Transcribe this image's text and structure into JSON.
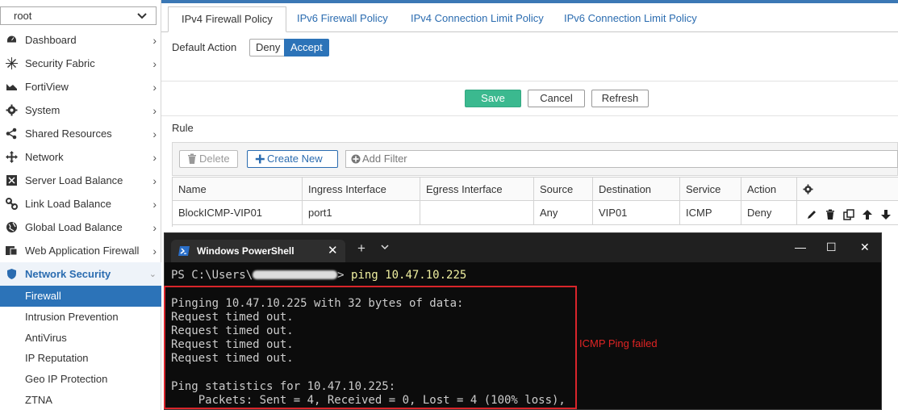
{
  "sidebar": {
    "vdom": "root",
    "items": [
      {
        "label": "Dashboard",
        "icon": "dashboard-icon"
      },
      {
        "label": "Security Fabric",
        "icon": "fabric-icon"
      },
      {
        "label": "FortiView",
        "icon": "chart-icon"
      },
      {
        "label": "System",
        "icon": "gear-icon"
      },
      {
        "label": "Shared Resources",
        "icon": "share-icon"
      },
      {
        "label": "Network",
        "icon": "network-icon"
      },
      {
        "label": "Server Load Balance",
        "icon": "server-icon"
      },
      {
        "label": "Link Load Balance",
        "icon": "link-icon"
      },
      {
        "label": "Global Load Balance",
        "icon": "globe-icon"
      },
      {
        "label": "Web Application Firewall",
        "icon": "waf-icon"
      },
      {
        "label": "Network Security",
        "icon": "shield-icon"
      }
    ],
    "sub_items": [
      {
        "label": "Firewall"
      },
      {
        "label": "Intrusion Prevention"
      },
      {
        "label": "AntiVirus"
      },
      {
        "label": "IP Reputation"
      },
      {
        "label": "Geo IP Protection"
      },
      {
        "label": "ZTNA"
      }
    ]
  },
  "tabs": [
    {
      "label": "IPv4 Firewall Policy"
    },
    {
      "label": "IPv6 Firewall Policy"
    },
    {
      "label": "IPv4 Connection Limit Policy"
    },
    {
      "label": "IPv6 Connection Limit Policy"
    }
  ],
  "default_action": {
    "label": "Default Action",
    "options": [
      "Deny",
      "Accept"
    ],
    "selected": "Accept"
  },
  "actions": {
    "save": "Save",
    "cancel": "Cancel",
    "refresh": "Refresh"
  },
  "rule_section": {
    "title": "Rule",
    "delete_label": "Delete",
    "create_label": "Create New",
    "filter_placeholder": "Add Filter",
    "columns": [
      "Name",
      "Ingress Interface",
      "Egress Interface",
      "Source",
      "Destination",
      "Service",
      "Action"
    ],
    "rows": [
      {
        "name": "BlockICMP-VIP01",
        "ingress": "port1",
        "egress": "",
        "source": "Any",
        "destination": "VIP01",
        "service": "ICMP",
        "action": "Deny"
      }
    ]
  },
  "powershell": {
    "tab_title": "Windows PowerShell",
    "prompt_prefix": "PS C:\\Users\\",
    "prompt_suffix": "> ",
    "command": "ping 10.47.10.225",
    "output": [
      "Pinging 10.47.10.225 with 32 bytes of data:",
      "Request timed out.",
      "Request timed out.",
      "Request timed out.",
      "Request timed out.",
      "",
      "Ping statistics for 10.47.10.225:",
      "    Packets: Sent = 4, Received = 0, Lost = 4 (100% loss),"
    ]
  },
  "annotation": {
    "text": "ICMP Ping failed",
    "color": "#e02424"
  },
  "colors": {
    "accent": "#2c73b8",
    "save": "#3bb98f",
    "terminal_bg": "#0c0c0c"
  }
}
